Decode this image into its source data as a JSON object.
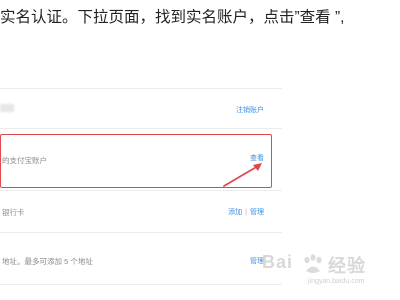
{
  "instruction_text": "实名认证。下拉页面，找到实名账户，点击”查看 ”,",
  "rows": [
    {
      "title": "",
      "action": "注销账户"
    },
    {
      "title": "的支付宝账户",
      "action": "查看"
    },
    {
      "title": "银行卡",
      "actions": [
        "添加",
        "管理"
      ],
      "separator": "|"
    },
    {
      "title": "地址。最多可添加 5 个地址",
      "action": "管理"
    }
  ],
  "colors": {
    "highlight": "#e0484b",
    "link": "#3a8ee6"
  },
  "watermark": {
    "brand": "Bai",
    "brand_suffix": "经验",
    "url": "jingyan.baidu.com"
  }
}
